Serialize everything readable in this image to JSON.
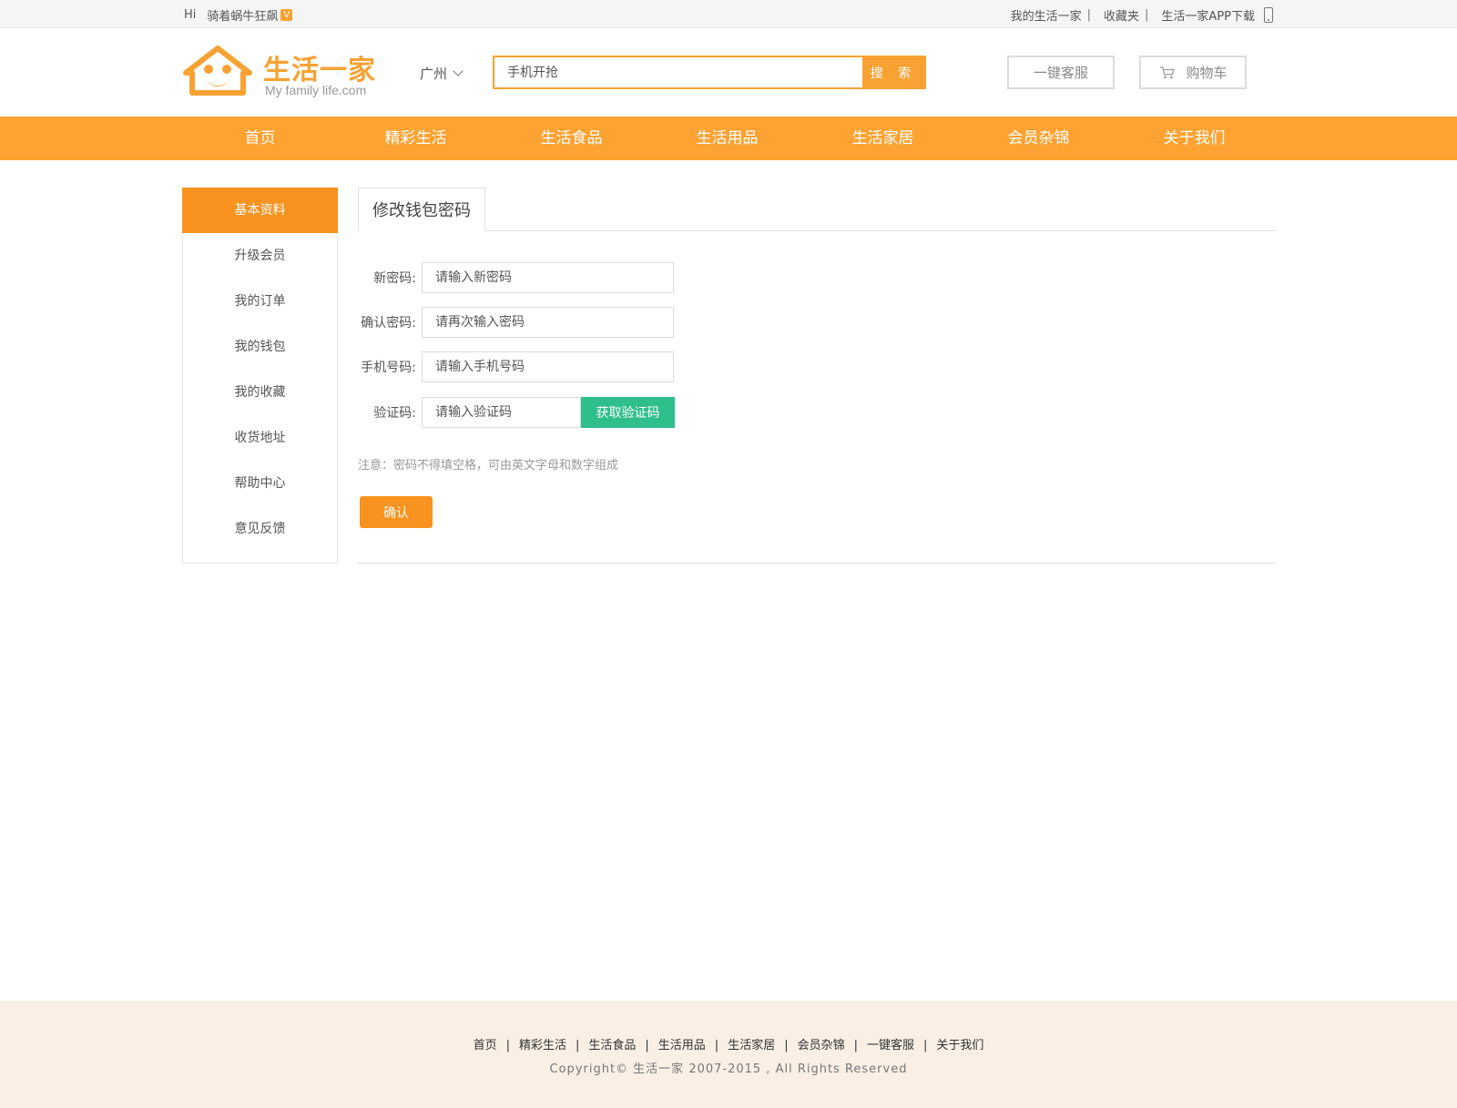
{
  "topbar": {
    "greeting": "Hi",
    "username": "骑着蜗牛狂飙",
    "vip_badge": "V",
    "links": [
      "我的生活一家",
      "收藏夹",
      "生活一家APP下载"
    ],
    "separator": "|"
  },
  "header": {
    "logo_cn": "生活一家",
    "logo_en": "My family life.com",
    "city": "广州",
    "search_placeholder": "手机开抢",
    "search_button": "搜 索",
    "service_button": "一键客服",
    "cart_button": "购物车"
  },
  "nav": {
    "items": [
      "首页",
      "精彩生活",
      "生活食品",
      "生活用品",
      "生活家居",
      "会员杂锦",
      "关于我们"
    ]
  },
  "sidebar": {
    "items": [
      "基本资料",
      "升级会员",
      "我的订单",
      "我的钱包",
      "我的收藏",
      "收货地址",
      "帮助中心",
      "意见反馈"
    ],
    "active_index": 0
  },
  "form": {
    "tab_title": "修改钱包密码",
    "new_password_label": "新密码:",
    "new_password_placeholder": "请输入新密码",
    "confirm_password_label": "确认密码:",
    "confirm_password_placeholder": "请再次输入密码",
    "phone_label": "手机号码:",
    "phone_placeholder": "请输入手机号码",
    "code_label": "验证码:",
    "code_placeholder": "请输入验证码",
    "get_code_button": "获取验证码",
    "note": "注意：密码不得填空格，可由英文字母和数字组成",
    "confirm_button": "确认"
  },
  "footer": {
    "links": [
      "首页",
      "精彩生活",
      "生活食品",
      "生活用品",
      "生活家居",
      "会员杂锦",
      "一键客服",
      "关于我们"
    ],
    "separator": "|",
    "copyright": "Copyright© 生活一家 2007-2015 , All Rights Reserved"
  },
  "colors": {
    "brand_orange": "#f7a233",
    "nav_orange": "#fea231",
    "active_orange": "#f7931e",
    "code_green": "#2fbf8a",
    "footer_bg": "#f9efe4"
  }
}
